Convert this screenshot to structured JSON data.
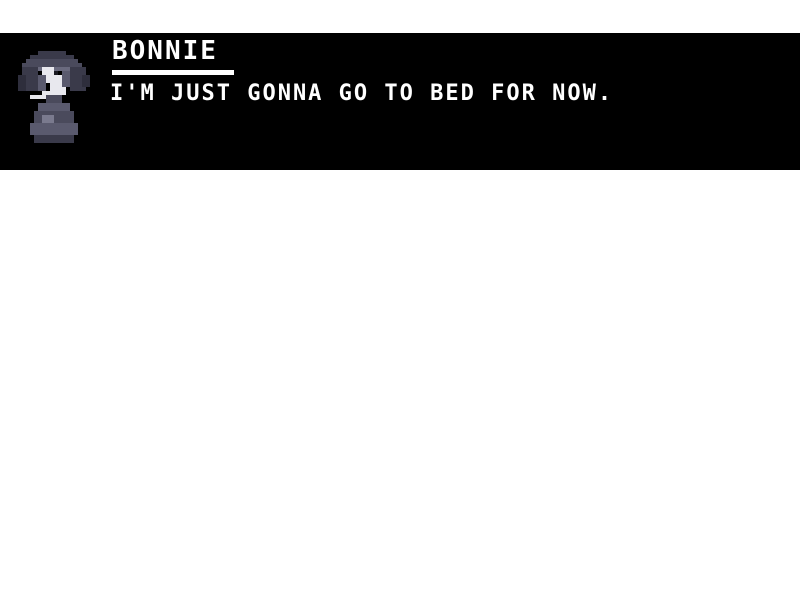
{
  "dialog": {
    "speaker": "BONNIE",
    "text": "I'M JUST GONNA GO TO BED FOR NOW.",
    "portrait_icon": "bonnie-portrait-icon"
  },
  "colors": {
    "background": "#ffffff",
    "dialog_box": "#000000",
    "text": "#ffffff",
    "portrait_dark": "#3a3a4a",
    "portrait_mid": "#6a6a7e",
    "portrait_light": "#e8e8ee"
  }
}
